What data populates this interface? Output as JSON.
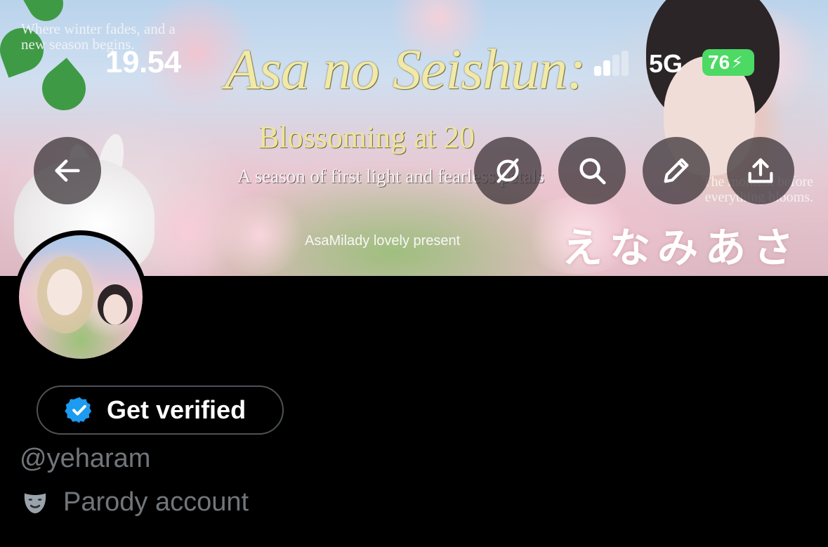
{
  "status_bar": {
    "time": "19.54",
    "network": "5G",
    "battery": "76"
  },
  "banner": {
    "top_left_text": "Where winter fades, and a new season begins.",
    "title": "Asa no Seishun:",
    "subtitle": "Blossoming at 20",
    "tagline": "A season of first light and fearless petals",
    "right_text": "The moment before everything blooms.",
    "present_text": "AsaMilady lovely present",
    "kana_text": "えなみあさ"
  },
  "nav": {
    "back_icon": "arrow-left-icon",
    "grok_icon": "grok-icon",
    "search_icon": "search-icon",
    "edit_icon": "pencil-icon",
    "share_icon": "share-icon"
  },
  "profile": {
    "get_verified_label": "Get verified",
    "handle": "@yeharam",
    "account_label": "Parody account"
  },
  "colors": {
    "background": "#000000",
    "verified_blue": "#1d9bf0",
    "secondary_text": "#71767b",
    "battery_green": "#4cd964"
  }
}
